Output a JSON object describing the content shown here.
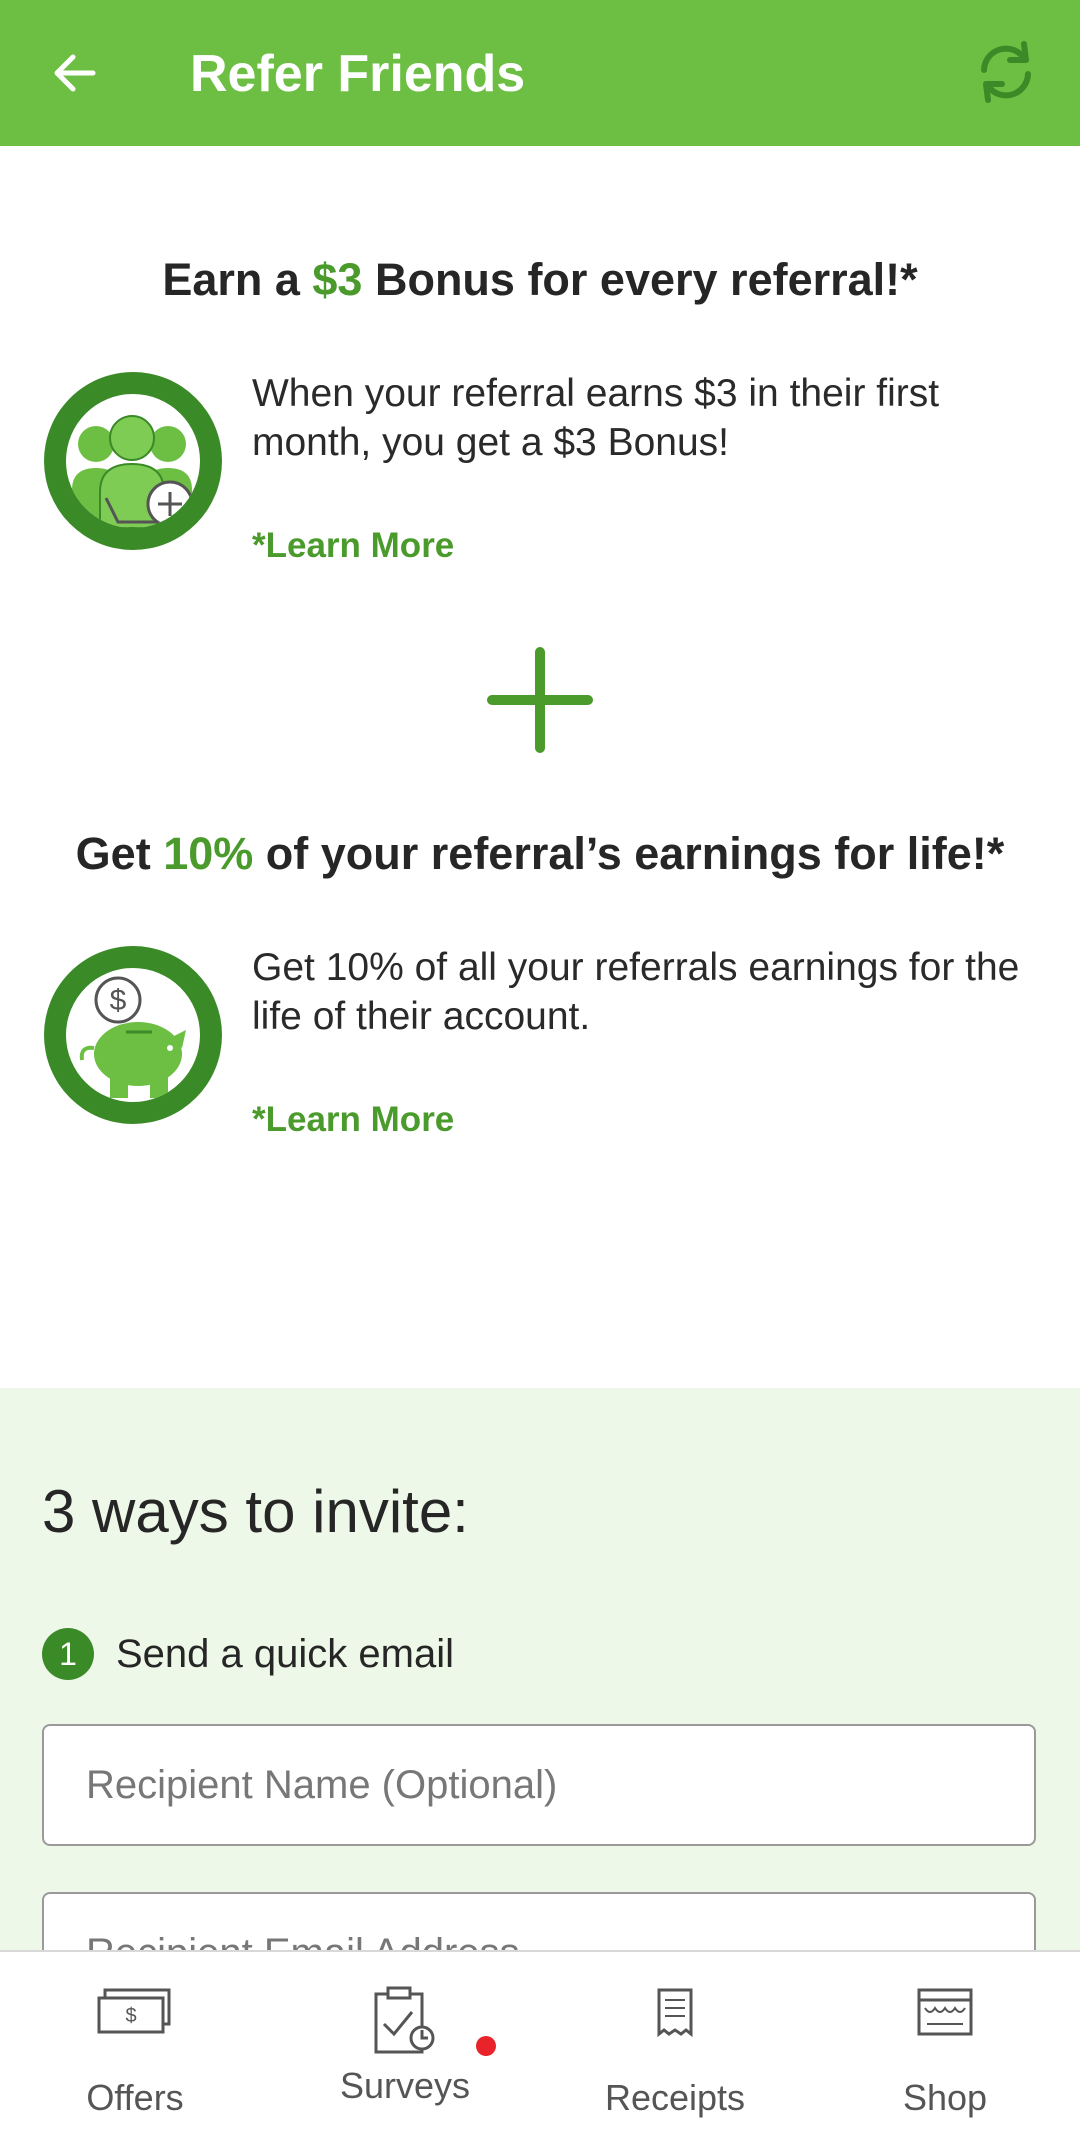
{
  "header": {
    "title": "Refer Friends",
    "back_icon": "arrow-left-icon",
    "refresh_icon": "refresh-icon"
  },
  "bonus": {
    "headline_pre": "Earn a ",
    "headline_accent": "$3",
    "headline_post": " Bonus for every referral!*",
    "description": "When your referral earns $3 in their first month, you get a $3 Bonus!",
    "learn_more": "*Learn More",
    "icon": "referral-group-icon"
  },
  "lifetime": {
    "headline_pre": "Get ",
    "headline_accent": "10%",
    "headline_post": " of your referral’s earnings for life!*",
    "description": "Get 10% of all your referrals earnings for the life of their account.",
    "learn_more": "*Learn More",
    "icon": "piggy-bank-icon"
  },
  "invite": {
    "title": "3 ways to invite:",
    "step_number": "1",
    "step_label": "Send a quick email",
    "name_placeholder": "Recipient Name (Optional)",
    "email_placeholder": "Recipient Email Address"
  },
  "nav": {
    "items": [
      {
        "label": "Offers",
        "icon": "offers-icon"
      },
      {
        "label": "Surveys",
        "icon": "surveys-icon"
      },
      {
        "label": "Receipts",
        "icon": "receipts-icon"
      },
      {
        "label": "Shop",
        "icon": "shop-icon"
      }
    ]
  },
  "colors": {
    "brand_green": "#6cbf43",
    "accent_green": "#4a9a2c",
    "badge_green": "#3a8a27",
    "panel_bg": "#eef8e8",
    "notification_red": "#e8232a"
  }
}
